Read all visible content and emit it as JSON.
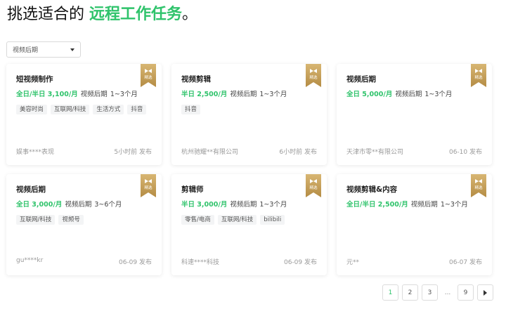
{
  "headline": {
    "prefix": "挑选适合的 ",
    "accent": "远程工作任务",
    "suffix": "。"
  },
  "filter": {
    "selected": "视频后期"
  },
  "colors": {
    "accent": "#2fc36b",
    "badge": "#c9a45c"
  },
  "badge_label": "精选",
  "jobs": [
    {
      "title": "短视频制作",
      "salary": "全日/半日 3,100/月",
      "category": "视频后期",
      "duration": "1~3个月",
      "tags": [
        "美容时尚",
        "互联网/科技",
        "生活方式",
        "抖音"
      ],
      "company": "娱事****表现",
      "posted": "5小时前 发布"
    },
    {
      "title": "视频剪辑",
      "salary": "半日 2,500/月",
      "category": "视频后期",
      "duration": "1~3个月",
      "tags": [
        "抖音"
      ],
      "company": "杭州驰耀**有限公司",
      "posted": "6小时前 发布"
    },
    {
      "title": "视频后期",
      "salary": "全日 5,000/月",
      "category": "视频后期",
      "duration": "1~3个月",
      "tags": [],
      "company": "天津市零**有限公司",
      "posted": "06-10 发布"
    },
    {
      "title": "视频后期",
      "salary": "全日 3,000/月",
      "category": "视频后期",
      "duration": "3~6个月",
      "tags": [
        "互联网/科技",
        "视频号"
      ],
      "company": "gu****kr",
      "posted": "06-09 发布"
    },
    {
      "title": "剪辑师",
      "salary": "半日 3,000/月",
      "category": "视频后期",
      "duration": "1~3个月",
      "tags": [
        "零售/电商",
        "互联网/科技",
        "bilibili"
      ],
      "company": "科速****科技",
      "posted": "06-09 发布"
    },
    {
      "title": "视频剪辑&内容",
      "salary": "全日/半日 2,500/月",
      "category": "视频后期",
      "duration": "1~3个月",
      "tags": [],
      "company": "元**",
      "posted": "06-07 发布"
    }
  ],
  "pagination": {
    "pages": [
      "1",
      "2",
      "3"
    ],
    "ellipsis": "...",
    "last": "9",
    "current": "1"
  }
}
